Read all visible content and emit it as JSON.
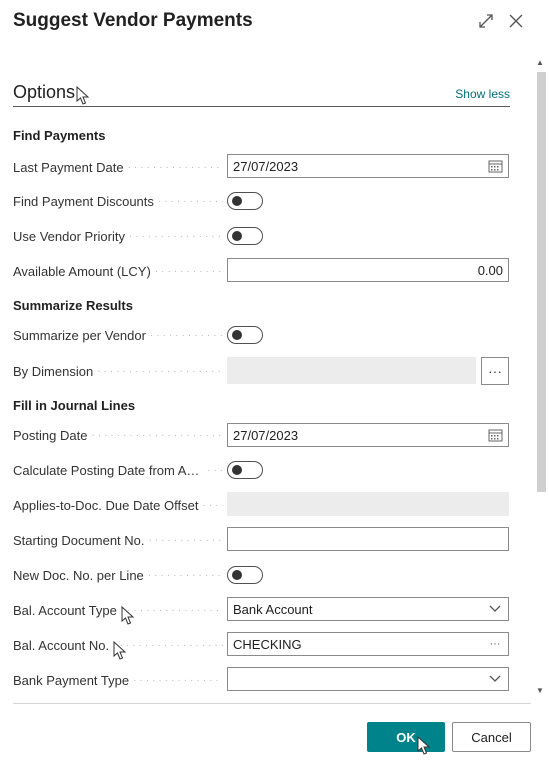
{
  "dialog": {
    "title": "Suggest Vendor Payments",
    "expand_icon": "expand-icon",
    "close_icon": "close-icon"
  },
  "options": {
    "title": "Options",
    "show_less": "Show less"
  },
  "groups": {
    "find_payments": "Find Payments",
    "summarize_results": "Summarize Results",
    "fill_in_journal_lines": "Fill in Journal Lines"
  },
  "fields": {
    "last_payment_date": {
      "label": "Last Payment Date",
      "value": "27/07/2023"
    },
    "find_payment_discounts": {
      "label": "Find Payment Discounts",
      "on": false
    },
    "use_vendor_priority": {
      "label": "Use Vendor Priority",
      "on": false
    },
    "available_amount": {
      "label": "Available Amount (LCY)",
      "value": "0.00"
    },
    "summarize_per_vendor": {
      "label": "Summarize per Vendor",
      "on": false
    },
    "by_dimension": {
      "label": "By Dimension",
      "value": ""
    },
    "posting_date": {
      "label": "Posting Date",
      "value": "27/07/2023"
    },
    "calc_posting_date": {
      "label": "Calculate Posting Date from Ap...",
      "on": false
    },
    "due_date_offset": {
      "label": "Applies-to-Doc. Due Date Offset",
      "value": ""
    },
    "starting_doc_no": {
      "label": "Starting Document No.",
      "value": ""
    },
    "new_doc_no_per_line": {
      "label": "New Doc. No. per Line",
      "on": false
    },
    "bal_account_type": {
      "label": "Bal. Account Type",
      "value": "Bank Account"
    },
    "bal_account_no": {
      "label": "Bal. Account No.",
      "value": "CHECKING"
    },
    "bank_payment_type": {
      "label": "Bank Payment Type",
      "value": ""
    }
  },
  "buttons": {
    "ok": "OK",
    "cancel": "Cancel"
  },
  "colors": {
    "accent": "#00838a",
    "link": "#00707a"
  }
}
